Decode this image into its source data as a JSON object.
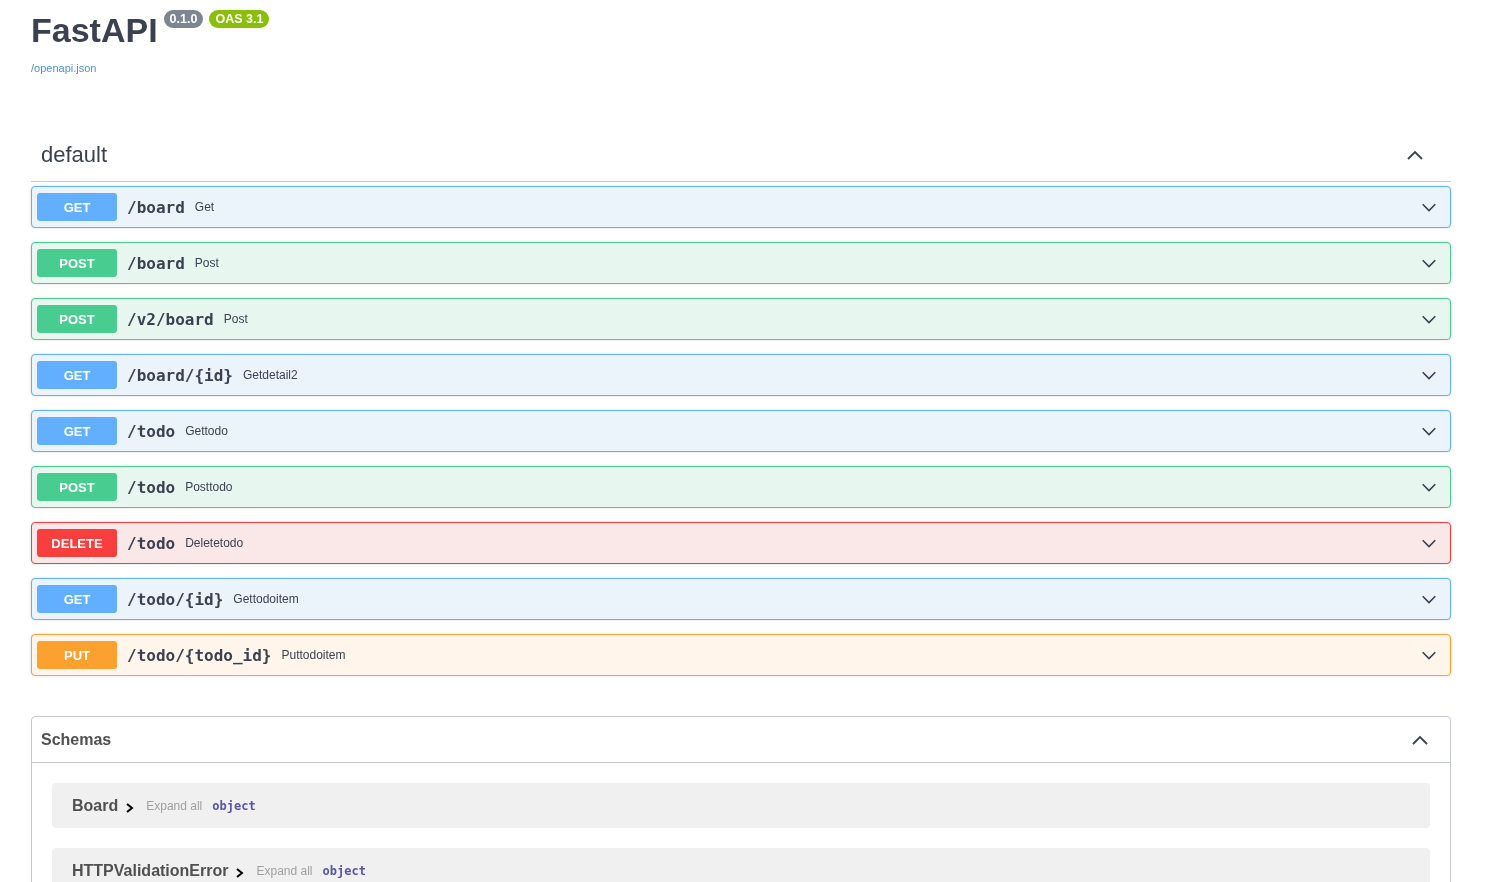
{
  "info": {
    "title": "FastAPI",
    "version": "0.1.0",
    "oas": "OAS 3.1",
    "spec_link": "/openapi.json"
  },
  "tag": {
    "name": "default",
    "expanded": true
  },
  "operations": [
    {
      "method": "GET",
      "path": "/board",
      "summary": "Get",
      "expanded": false
    },
    {
      "method": "POST",
      "path": "/board",
      "summary": "Post",
      "expanded": false
    },
    {
      "method": "POST",
      "path": "/v2/board",
      "summary": "Post",
      "expanded": false
    },
    {
      "method": "GET",
      "path": "/board/{id}",
      "summary": "Getdetail2",
      "expanded": false
    },
    {
      "method": "GET",
      "path": "/todo",
      "summary": "Gettodo",
      "expanded": false
    },
    {
      "method": "POST",
      "path": "/todo",
      "summary": "Posttodo",
      "expanded": false
    },
    {
      "method": "DELETE",
      "path": "/todo",
      "summary": "Deletetodo",
      "expanded": false
    },
    {
      "method": "GET",
      "path": "/todo/{id}",
      "summary": "Gettodoitem",
      "expanded": false
    },
    {
      "method": "PUT",
      "path": "/todo/{todo_id}",
      "summary": "Puttodoitem",
      "expanded": false
    }
  ],
  "schemas": {
    "title": "Schemas",
    "expanded": true,
    "models": [
      {
        "name": "Board",
        "expand_all": "Expand all",
        "type": "object"
      },
      {
        "name": "HTTPValidationError",
        "expand_all": "Expand all",
        "type": "object"
      }
    ]
  }
}
